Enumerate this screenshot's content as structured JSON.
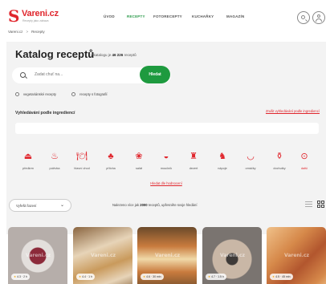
{
  "header": {
    "logo_text": "Vareni.cz",
    "logo_sub": "Recepty jako zábava",
    "logo_mark": "S",
    "nav": [
      "ÚVOD",
      "RECEPTY",
      "FOTORECEPTY",
      "KUCHAŘKY",
      "MAGAZÍN"
    ],
    "active_nav": "RECEPTY",
    "icons": [
      "search-icon",
      "user-icon"
    ]
  },
  "breadcrumb": [
    "Vareni.cz",
    "Recepty"
  ],
  "breadcrumb_sep": ">",
  "hero": {
    "title": "Katalog receptů",
    "subtitle_prefix": "v katalogu je",
    "subtitle_count": "46 226",
    "subtitle_suffix": "receptů",
    "search_placeholder": "Zadat chuť na...",
    "search_button": "Hledat",
    "filters": [
      "vegetariánské recepty",
      "recepty s fotografií"
    ],
    "ingredients_title": "Vyhledávání podle ingrediencí",
    "ingredients_link": "Zrušit vyhledávání podle ingrediencí",
    "more_filters": "Hledat dle hodnocení"
  },
  "categories": [
    {
      "label": "předkrm",
      "icon": "appetizer-icon",
      "glyph": "⏏"
    },
    {
      "label": "polévka",
      "icon": "soup-icon",
      "glyph": "♨"
    },
    {
      "label": "hlavní chod",
      "icon": "main-course-icon",
      "glyph": "🍽"
    },
    {
      "label": "příloha",
      "icon": "side-dish-icon",
      "glyph": "♣"
    },
    {
      "label": "salát",
      "icon": "salad-icon",
      "glyph": "❀"
    },
    {
      "label": "moučník",
      "icon": "dessert-icon",
      "glyph": "◒"
    },
    {
      "label": "dezert",
      "icon": "cake-icon",
      "glyph": "♜"
    },
    {
      "label": "nápoje",
      "icon": "drinks-icon",
      "glyph": "♞"
    },
    {
      "label": "omáčky",
      "icon": "sauce-icon",
      "glyph": "◡"
    },
    {
      "label": "dochutky",
      "icon": "spices-icon",
      "glyph": "⚱"
    },
    {
      "label": "další",
      "icon": "more-icon",
      "glyph": "⊙"
    }
  ],
  "sort": {
    "selected": "Vyřešit řazení",
    "found_prefix": "Nalezeno více jak",
    "found_count": "2000",
    "found_suffix": "receptů, upřesněte svoje hledání",
    "view_icons": [
      "list-view-icon",
      "grid-view-icon"
    ]
  },
  "recipes": [
    {
      "rating": "4.3",
      "time": "2 h",
      "watermark": "Vareni.cz",
      "colors": [
        "#d9d4d0",
        "#8c2a3a",
        "#b6aeaa"
      ]
    },
    {
      "rating": "4.4",
      "time": "1 h",
      "watermark": "Vareni.cz",
      "colors": [
        "#c99a5c",
        "#e7d4b8",
        "#8a6540"
      ]
    },
    {
      "rating": "4.6",
      "time": "30 min",
      "watermark": "Vareni.cz",
      "colors": [
        "#c97b3e",
        "#f0d9a8",
        "#6b4a2a"
      ]
    },
    {
      "rating": "4.7",
      "time": "1.5 h",
      "watermark": "Vareni.cz",
      "colors": [
        "#7a7470",
        "#c9b7a6",
        "#3e3a38"
      ]
    },
    {
      "rating": "4.5",
      "time": "45 min",
      "watermark": "Vareni.cz",
      "colors": [
        "#d6894a",
        "#b2562e",
        "#f0c18a"
      ]
    }
  ]
}
